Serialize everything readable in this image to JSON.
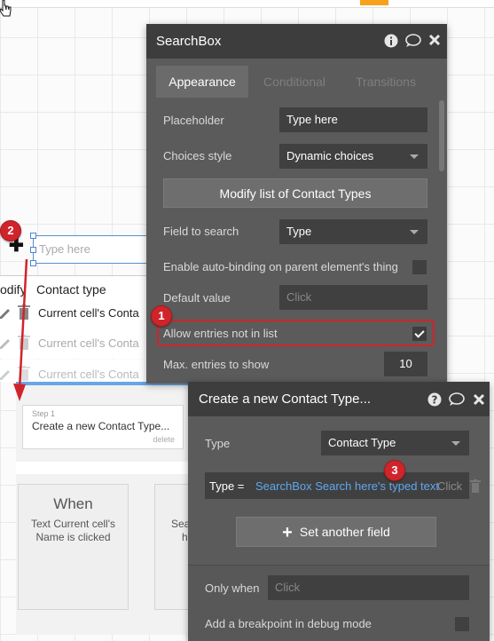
{
  "canvas": {
    "searchbox_placeholder": "Type here",
    "table_header": {
      "col_modify": "odify",
      "col_contact_type": "Contact type"
    },
    "table_rows": [
      {
        "cell": "Current cell's Conta"
      },
      {
        "cell": "Current cell's Conta"
      },
      {
        "cell": "Current cell's Conta"
      }
    ],
    "workflow": {
      "step_label": "Step 1",
      "step_title": "Create a new Contact Type...",
      "step_delete": "delete",
      "when_title": "When",
      "when_text": "Text Current cell's Name is clicked",
      "card2_text_line1": "Sea",
      "card2_text_line2": "h"
    }
  },
  "badges": {
    "b1": "1",
    "b2": "2",
    "b3": "3"
  },
  "searchbox_panel": {
    "title": "SearchBox",
    "icons": [
      "info-icon",
      "comment-icon",
      "close-icon"
    ],
    "tabs": [
      "Appearance",
      "Conditional",
      "Transitions"
    ],
    "placeholder_label": "Placeholder",
    "placeholder_value": "Type here",
    "choices_style_label": "Choices style",
    "choices_style_value": "Dynamic choices",
    "modify_button": "Modify list of Contact Types",
    "field_to_search_label": "Field to search",
    "field_to_search_value": "Type",
    "auto_binding_label": "Enable auto-binding on parent element's thing",
    "auto_binding_checked": false,
    "default_value_label": "Default value",
    "default_value_placeholder": "Click",
    "allow_entries_label": "Allow entries not in list",
    "allow_entries_checked": true,
    "max_entries_label": "Max. entries to show",
    "max_entries_value": "10"
  },
  "action_panel": {
    "title": "Create a new Contact Type...",
    "icons": [
      "help-icon",
      "comment-icon",
      "close-icon"
    ],
    "type_label": "Type",
    "type_value": "Contact Type",
    "field_key": "Type =",
    "field_value": "SearchBox Search here's typed text",
    "field_click": "Click",
    "set_field_button": "Set another field",
    "only_when_label": "Only when",
    "only_when_placeholder": "Click",
    "breakpoint_label": "Add a breakpoint in debug mode",
    "breakpoint_checked": false
  },
  "colors": {
    "panel_bg": "#5b5b5b",
    "panel_header": "#3d3d3d",
    "field_bg": "#404040",
    "highlight_red": "#d0242b",
    "link_blue": "#5ea7f0",
    "accent_orange": "#f7a21b"
  }
}
